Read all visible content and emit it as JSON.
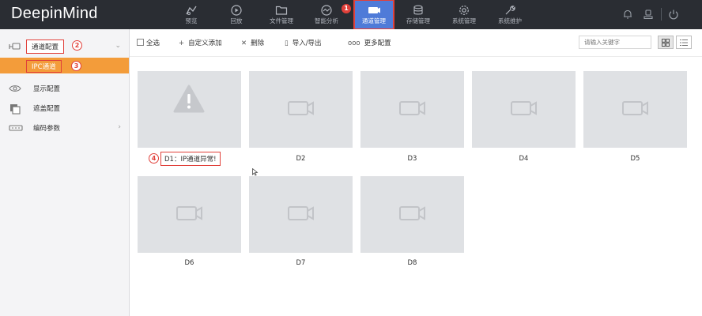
{
  "app": {
    "title": "DeepinMind"
  },
  "nav": {
    "items": [
      {
        "label": "预览",
        "icon": "preview-icon"
      },
      {
        "label": "回放",
        "icon": "playback-icon"
      },
      {
        "label": "文件管理",
        "icon": "folder-icon"
      },
      {
        "label": "智能分析",
        "icon": "analysis-icon"
      },
      {
        "label": "通道管理",
        "icon": "channel-icon",
        "active": true
      },
      {
        "label": "存储管理",
        "icon": "storage-icon"
      },
      {
        "label": "系统管理",
        "icon": "gear-icon"
      },
      {
        "label": "系统维护",
        "icon": "wrench-icon"
      }
    ],
    "active_marker": "1"
  },
  "topbar_icons": [
    "bell-icon",
    "user-icon",
    "power-icon"
  ],
  "sidebar": {
    "items": [
      {
        "label": "通道配置",
        "icon": "camera-config-icon",
        "expanded": true,
        "marker": "2"
      },
      {
        "label": "IPC通道",
        "selected": true,
        "marker": "3"
      },
      {
        "label": "显示配置",
        "icon": "eye-icon"
      },
      {
        "label": "遮盖配置",
        "icon": "mask-icon"
      },
      {
        "label": "编码参数",
        "icon": "encode-icon"
      }
    ]
  },
  "toolbar": {
    "select_all": "全选",
    "add_custom": "自定义添加",
    "delete": "删除",
    "import_export": "导入/导出",
    "more_config": "更多配置",
    "search_placeholder": "请输入关键字"
  },
  "channels": [
    {
      "name": "D1：IP通道异常!",
      "status": "error",
      "marker": "4"
    },
    {
      "name": "D2"
    },
    {
      "name": "D3"
    },
    {
      "name": "D4"
    },
    {
      "name": "D5"
    },
    {
      "name": "D6"
    },
    {
      "name": "D7"
    },
    {
      "name": "D8"
    }
  ],
  "colors": {
    "topbar": "#2a2d33",
    "active_nav": "#4f7bd8",
    "sidebar_selected": "#f39c3a",
    "annotation_red": "#e1403a",
    "tile_bg": "#dfe1e4"
  }
}
